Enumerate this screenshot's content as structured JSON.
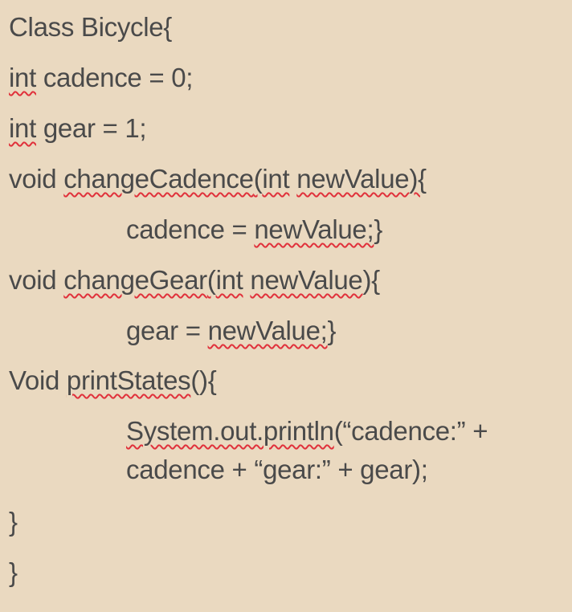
{
  "slide": {
    "background_color": "#ead9c0",
    "text_color": "#4a4a4a",
    "spellcheck_color": "#e0313b",
    "code": {
      "l1": {
        "t1": "Class Bicycle{"
      },
      "l2": {
        "t1": "int",
        "t2": " cadence = 0;"
      },
      "l3": {
        "t1": "int",
        "t2": " gear = 1;"
      },
      "l4": {
        "t1": "void ",
        "t2": "changeCadence",
        "t3": "(",
        "t4": "int",
        "t5": " ",
        "t6": "newValue",
        "t7": "){"
      },
      "l5": {
        "t1": "cadence = ",
        "t2": "newValue;",
        "t3": "}"
      },
      "l6": {
        "t1": "void ",
        "t2": "changeGear",
        "t3": "(",
        "t4": "int",
        "t5": " ",
        "t6": "newValue",
        "t7": "){"
      },
      "l7": {
        "t1": "gear = ",
        "t2": "newValue;",
        "t3": "}"
      },
      "l8": {
        "t1": "Void ",
        "t2": "printStates",
        "t3": "(){"
      },
      "l9": {
        "t1": "System.out.println",
        "t2": "(“cadence:” +"
      },
      "l10": {
        "t1": "cadence + “gear:” + gear);"
      },
      "l11": {
        "t1": "}"
      },
      "l12": {
        "t1": "}"
      }
    }
  }
}
